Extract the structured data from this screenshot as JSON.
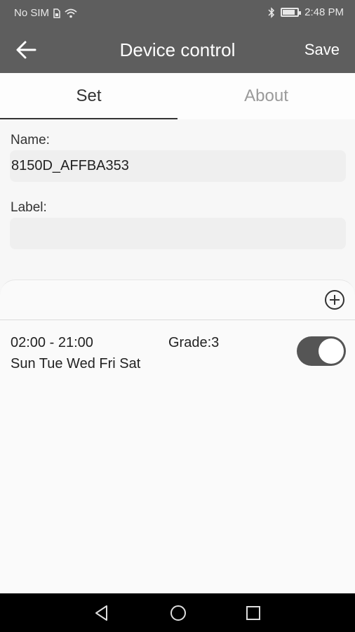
{
  "status_bar": {
    "carrier": "No SIM",
    "time": "2:48 PM",
    "battery_level": 0.85,
    "icons": [
      "sim-icon",
      "wifi-icon",
      "bluetooth-icon",
      "battery-icon"
    ]
  },
  "app_bar": {
    "title": "Device control",
    "save_label": "Save",
    "back_icon": "arrow-left-icon"
  },
  "tabs": [
    {
      "label": "Set",
      "active": true
    },
    {
      "label": "About",
      "active": false
    }
  ],
  "form": {
    "name_label": "Name:",
    "name_value": "8150D_AFFBA353",
    "label_label": "Label:",
    "label_value": ""
  },
  "schedule": {
    "add_icon": "plus-circle-icon",
    "items": [
      {
        "time": "02:00 - 21:00",
        "grade": "Grade:3",
        "days": "Sun Tue Wed Fri Sat",
        "enabled": true
      }
    ]
  },
  "nav_bar": {
    "icons": [
      "back-triangle-icon",
      "home-circle-icon",
      "recents-square-icon"
    ]
  },
  "colors": {
    "header": "#5e5e5e",
    "toggle_on": "#555555",
    "background": "#f7f7f7"
  }
}
